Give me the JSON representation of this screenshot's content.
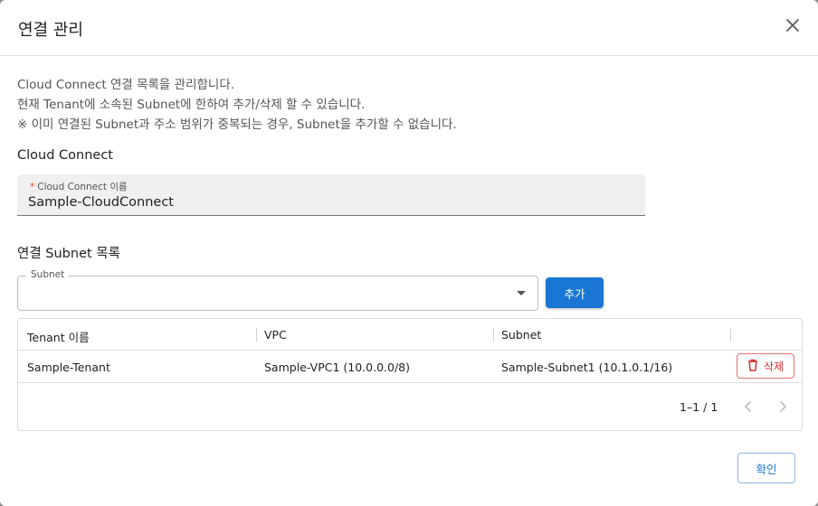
{
  "dialog": {
    "title": "연결 관리",
    "description": [
      "Cloud Connect 연결 목록을 관리합니다.",
      "현재 Tenant에 소속된 Subnet에 한하여 추가/삭제 할 수 있습니다.",
      "※ 이미 연결된 Subnet과 주소 범위가 중복되는 경우, Subnet을 추가할 수 없습니다."
    ],
    "cloud_connect": {
      "section_title": "Cloud Connect",
      "required_mark": "*",
      "field_label": "Cloud Connect 이름",
      "field_value": "Sample-CloudConnect"
    },
    "subnet_section": {
      "section_title": "연결 Subnet 목록",
      "select_label": "Subnet",
      "select_value": "",
      "add_label": "추가"
    },
    "table": {
      "columns": [
        "Tenant 이름",
        "VPC",
        "Subnet"
      ],
      "rows": [
        {
          "tenant": "Sample-Tenant",
          "vpc": "Sample-VPC1 (10.0.0.0/8)",
          "subnet": "Sample-Subnet1 (10.1.0.1/16)",
          "delete_label": "삭제"
        }
      ],
      "pagination": "1–1 / 1"
    },
    "confirm_label": "확인"
  },
  "colors": {
    "primary": "#1976d2",
    "danger": "#d32f2f",
    "required": "#e2471f"
  },
  "icons": [
    "close-icon",
    "dropdown-arrow-icon",
    "trash-icon",
    "chevron-left-icon",
    "chevron-right-icon"
  ]
}
